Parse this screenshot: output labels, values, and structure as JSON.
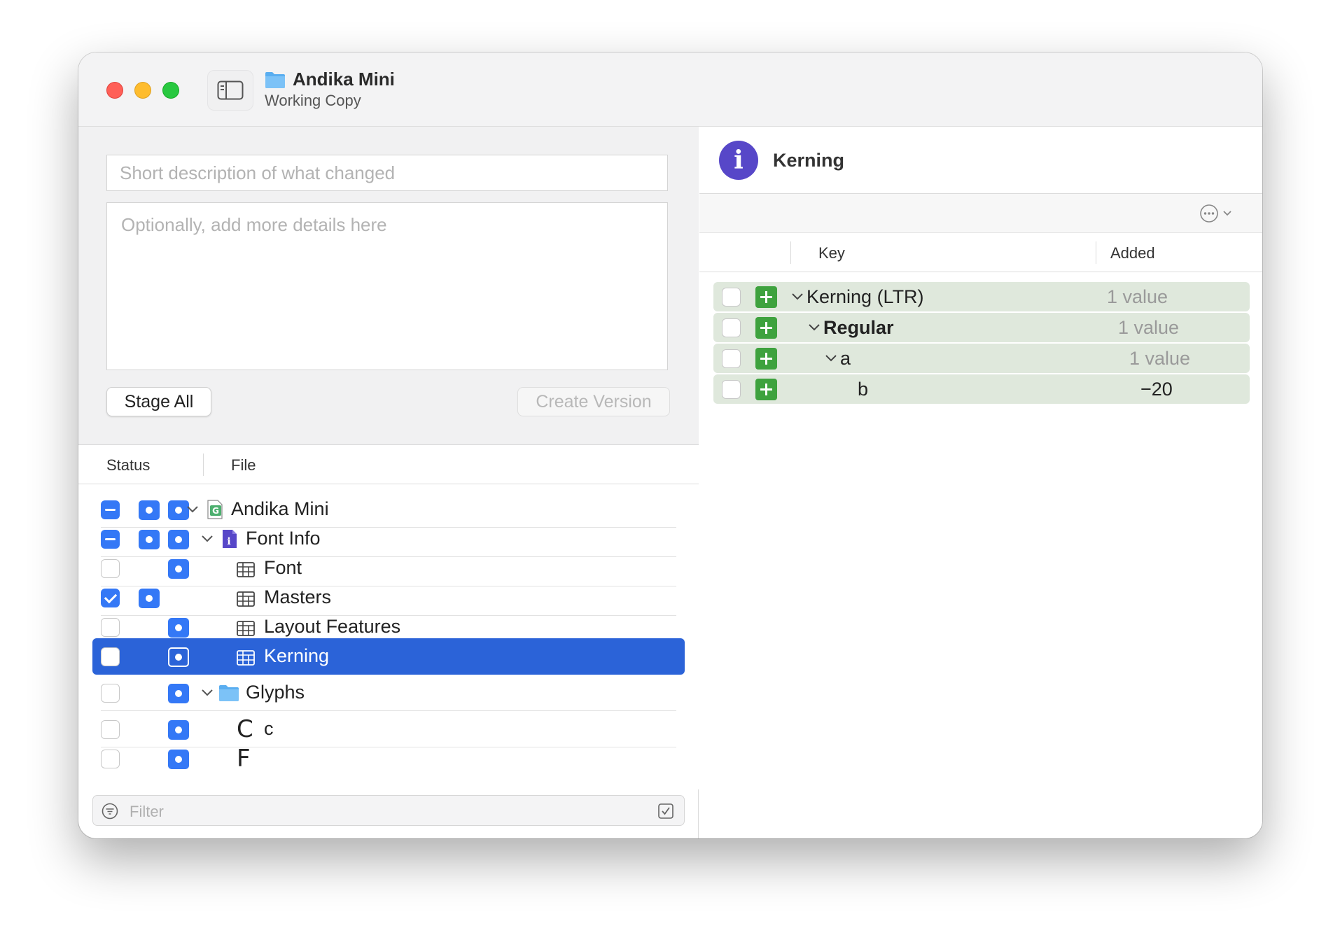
{
  "window": {
    "title": "Andika Mini",
    "subtitle": "Working Copy"
  },
  "commit": {
    "summary_placeholder": "Short description of what changed",
    "details_placeholder": "Optionally, add more details here",
    "stage_all_label": "Stage All",
    "create_version_label": "Create Version"
  },
  "file_list": {
    "header_status": "Status",
    "header_file": "File",
    "rows": [
      {
        "name": "Andika Mini",
        "check": "mixed"
      },
      {
        "name": "Font Info",
        "check": "mixed"
      },
      {
        "name": "Font",
        "check": "unchecked"
      },
      {
        "name": "Masters",
        "check": "checked"
      },
      {
        "name": "Layout Features",
        "check": "unchecked"
      },
      {
        "name": "Kerning",
        "check": "unchecked",
        "selected": true
      },
      {
        "name": "Glyphs",
        "check": "unchecked"
      },
      {
        "name": "c",
        "glyph": "C",
        "check": "unchecked"
      },
      {
        "glyph": "F",
        "check": "unchecked"
      }
    ]
  },
  "filter": {
    "placeholder": "Filter"
  },
  "detail": {
    "title": "Kerning",
    "header_key": "Key",
    "header_added": "Added",
    "rows": [
      {
        "key": "Kerning (LTR)",
        "added": "1 value"
      },
      {
        "key": "Regular",
        "added": "1 value"
      },
      {
        "key": "a",
        "added": "1 value"
      },
      {
        "key": "b",
        "added": "−20"
      }
    ]
  },
  "colors": {
    "accent": "#3478f6",
    "selection": "#2b63d8",
    "added_row": "#dfe8dc",
    "added_badge": "#3ea23e",
    "info_badge": "#5747c8"
  },
  "icons": [
    "sidebar-toggle-icon",
    "folder-icon",
    "font-file-icon",
    "info-file-icon",
    "table-icon",
    "chevron-down-icon",
    "filter-icon",
    "checkmark-toggle-icon",
    "info-icon",
    "ellipsis-circle-icon",
    "plus-icon"
  ]
}
